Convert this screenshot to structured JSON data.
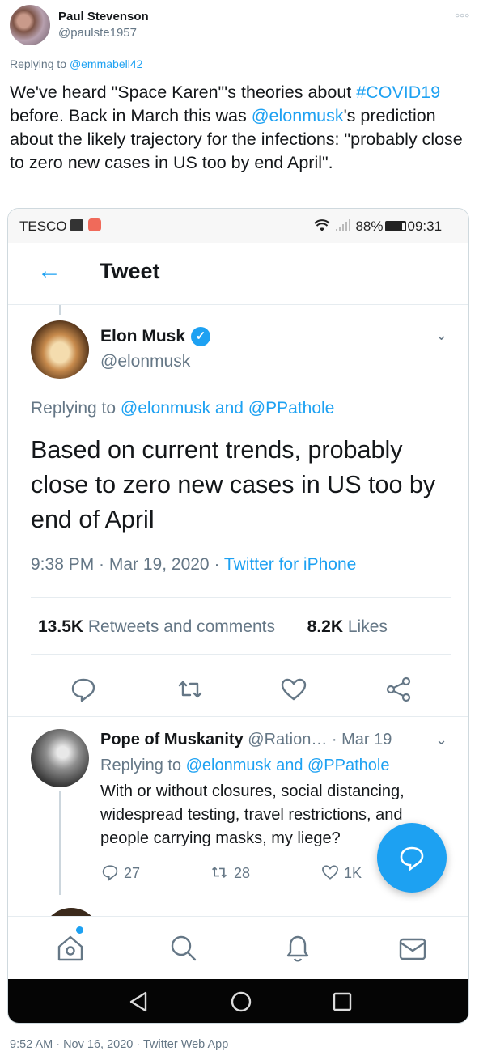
{
  "outer_tweet": {
    "name": "Paul Stevenson",
    "handle": "@paulste1957",
    "replying_prefix": "Replying to ",
    "replying_to": "@emmabell42",
    "text_parts": [
      {
        "t": "We've heard \"Space Karen\"'s theories about ",
        "link": false
      },
      {
        "t": "#COVID19",
        "link": true
      },
      {
        "t": " before. Back in March this was ",
        "link": false
      },
      {
        "t": "@elonmusk",
        "link": true
      },
      {
        "t": "'s prediction about the likely trajectory for the infections: \"probably close to zero new cases in US too by end April\".",
        "link": false
      }
    ],
    "footer": "9:52 AM · Nov 16, 2020 · Twitter Web App"
  },
  "phone": {
    "status": {
      "carrier": "TESCO",
      "battery": "88%",
      "time": "09:31"
    },
    "header": {
      "title": "Tweet"
    },
    "main_tweet": {
      "name": "Elon Musk",
      "handle": "@elonmusk",
      "replying_prefix": "Replying to ",
      "replying_to": "@elonmusk and @PPathole",
      "text": "Based on current trends, probably close to zero new cases in US too by end of April",
      "time": "9:38 PM · Mar 19, 2020 · ",
      "source": "Twitter for iPhone",
      "retweets_count": "13.5K",
      "retweets_label": " Retweets and comments",
      "likes_count": "8.2K",
      "likes_label": " Likes"
    },
    "reply": {
      "name": "Pope of Muskanity",
      "handle_date": " @Ration… · Mar 19",
      "replying_prefix": "Replying to ",
      "replying_to": "@elonmusk and @PPathole",
      "text": "With or without closures, social distancing, widespread testing, travel restrictions, and people carrying masks, my liege?",
      "replies": "27",
      "retweets": "28",
      "likes": "1K"
    }
  },
  "colors": {
    "accent": "#1da1f2",
    "text": "#14171a",
    "muted": "#657786"
  }
}
